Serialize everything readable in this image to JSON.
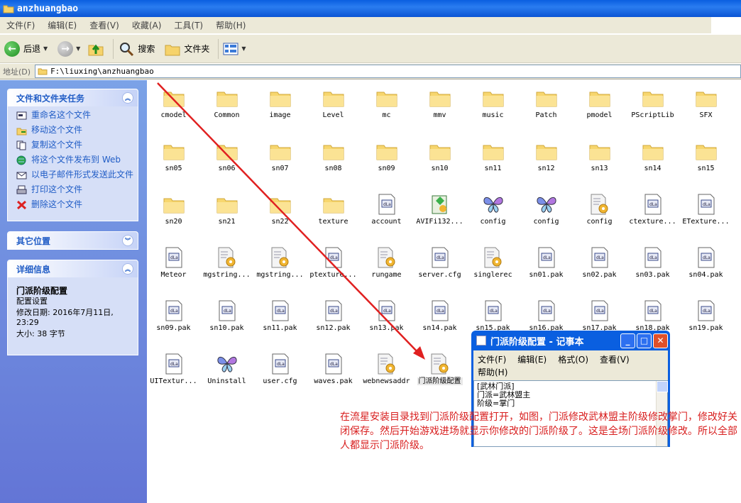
{
  "window": {
    "title": "anzhuangbao"
  },
  "menubar": [
    "文件(F)",
    "编辑(E)",
    "查看(V)",
    "收藏(A)",
    "工具(T)",
    "帮助(H)"
  ],
  "toolbar": {
    "back": "后退",
    "search": "搜索",
    "folders": "文件夹"
  },
  "address": {
    "label": "地址(D)",
    "value": "F:\\liuxing\\anzhuangbao"
  },
  "left": {
    "tasks_title": "文件和文件夹任务",
    "tasks": [
      "重命名这个文件",
      "移动这个文件",
      "复制这个文件",
      "将这个文件发布到 Web",
      "以电子邮件形式发送此文件",
      "打印这个文件",
      "删除这个文件"
    ],
    "other_title": "其它位置",
    "details_title": "详细信息",
    "details": {
      "name": "门派阶级配置",
      "type": "配置设置",
      "modified": "修改日期: 2016年7月11日, 23:29",
      "size": "大小: 38 字节"
    }
  },
  "items": [
    {
      "label": "cmodel",
      "icon": "folder"
    },
    {
      "label": "Common",
      "icon": "folder"
    },
    {
      "label": "image",
      "icon": "folder"
    },
    {
      "label": "Level",
      "icon": "folder"
    },
    {
      "label": "mc",
      "icon": "folder"
    },
    {
      "label": "mmv",
      "icon": "folder"
    },
    {
      "label": "music",
      "icon": "folder"
    },
    {
      "label": "Patch",
      "icon": "folder"
    },
    {
      "label": "pmodel",
      "icon": "folder"
    },
    {
      "label": "PScriptLib",
      "icon": "folder"
    },
    {
      "label": "SFX",
      "icon": "folder"
    },
    {
      "label": "sn05",
      "icon": "folder"
    },
    {
      "label": "sn06",
      "icon": "folder"
    },
    {
      "label": "sn07",
      "icon": "folder"
    },
    {
      "label": "sn08",
      "icon": "folder"
    },
    {
      "label": "sn09",
      "icon": "folder"
    },
    {
      "label": "sn10",
      "icon": "folder"
    },
    {
      "label": "sn11",
      "icon": "folder"
    },
    {
      "label": "sn12",
      "icon": "folder"
    },
    {
      "label": "sn13",
      "icon": "folder"
    },
    {
      "label": "sn14",
      "icon": "folder"
    },
    {
      "label": "sn15",
      "icon": "folder"
    },
    {
      "label": "sn20",
      "icon": "folder"
    },
    {
      "label": "sn21",
      "icon": "folder"
    },
    {
      "label": "sn22",
      "icon": "folder"
    },
    {
      "label": "texture",
      "icon": "folder"
    },
    {
      "label": "account",
      "icon": "file"
    },
    {
      "label": "AVIFi132...",
      "icon": "installer"
    },
    {
      "label": "config",
      "icon": "butterfly"
    },
    {
      "label": "config",
      "icon": "butterfly"
    },
    {
      "label": "config",
      "icon": "settings"
    },
    {
      "label": "ctexture...",
      "icon": "file"
    },
    {
      "label": "ETexture...",
      "icon": "file"
    },
    {
      "label": "Meteor",
      "icon": "file"
    },
    {
      "label": "mgstring...",
      "icon": "settings"
    },
    {
      "label": "mgstring...",
      "icon": "settings"
    },
    {
      "label": "ptexture...",
      "icon": "file"
    },
    {
      "label": "rungame",
      "icon": "settings"
    },
    {
      "label": "server.cfg",
      "icon": "file"
    },
    {
      "label": "singlerec",
      "icon": "settings"
    },
    {
      "label": "sn01.pak",
      "icon": "file"
    },
    {
      "label": "sn02.pak",
      "icon": "file"
    },
    {
      "label": "sn03.pak",
      "icon": "file"
    },
    {
      "label": "sn04.pak",
      "icon": "file"
    },
    {
      "label": "sn09.pak",
      "icon": "file"
    },
    {
      "label": "sn10.pak",
      "icon": "file"
    },
    {
      "label": "sn11.pak",
      "icon": "file"
    },
    {
      "label": "sn12.pak",
      "icon": "file"
    },
    {
      "label": "sn13.pak",
      "icon": "file"
    },
    {
      "label": "sn14.pak",
      "icon": "file"
    },
    {
      "label": "sn15.pak",
      "icon": "file"
    },
    {
      "label": "sn16.pak",
      "icon": "file"
    },
    {
      "label": "sn17.pak",
      "icon": "file"
    },
    {
      "label": "sn18.pak",
      "icon": "file"
    },
    {
      "label": "sn19.pak",
      "icon": "file"
    },
    {
      "label": "UITextur...",
      "icon": "file"
    },
    {
      "label": "Uninstall",
      "icon": "butterfly"
    },
    {
      "label": "user.cfg",
      "icon": "file"
    },
    {
      "label": "waves.pak",
      "icon": "file"
    },
    {
      "label": "webnewsaddr",
      "icon": "settings"
    },
    {
      "label": "门派阶级配置",
      "icon": "settings",
      "selected": true
    }
  ],
  "notepad": {
    "title": "门派阶级配置 - 记事本",
    "menu": [
      "文件(F)",
      "编辑(E)",
      "格式(O)",
      "查看(V)",
      "帮助(H)"
    ],
    "lines": [
      "[武林门派]",
      "门派=武林盟主",
      "阶级=掌门"
    ]
  },
  "annotation": "在流星安装目录找到门派阶级配置打开，如图，门派修改武林盟主阶级修改掌门，修改好关闭保存。然后开始游戏进场就显示你修改的门派阶级了。这是全场门派阶级修改。所以全部人都显示门派阶级。",
  "colors": {
    "xp_blue": "#0a5fe0",
    "task_link": "#215dc6",
    "annotation_red": "#d81e1e"
  }
}
